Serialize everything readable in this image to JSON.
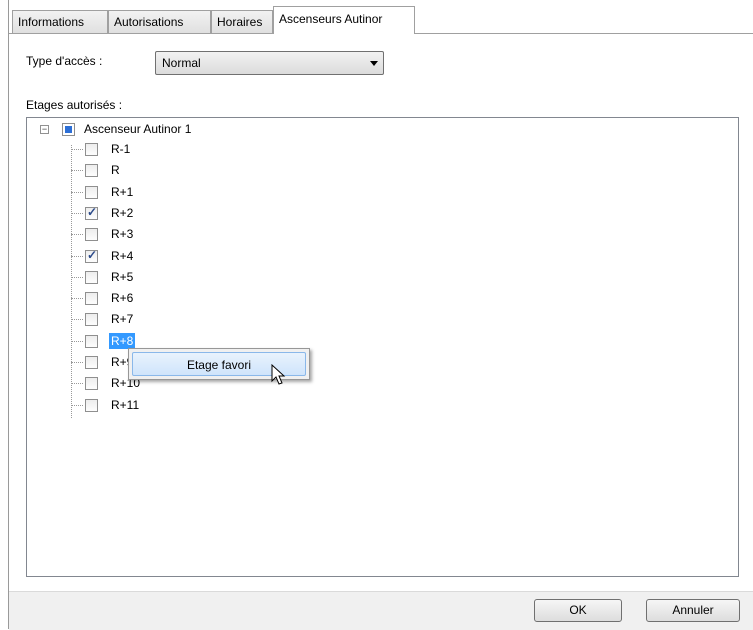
{
  "tabs": [
    {
      "label": "Informations"
    },
    {
      "label": "Autorisations"
    },
    {
      "label": "Horaires"
    },
    {
      "label": "Ascenseurs Autinor"
    }
  ],
  "access": {
    "label": "Type d'accès :",
    "value": "Normal"
  },
  "floors_label": "Etages autorisés :",
  "tree": {
    "root_label": "Ascenseur Autinor 1",
    "items": [
      {
        "label": "R-1",
        "checked": false
      },
      {
        "label": "R",
        "checked": false
      },
      {
        "label": "R+1",
        "checked": false
      },
      {
        "label": "R+2",
        "checked": true
      },
      {
        "label": "R+3",
        "checked": false
      },
      {
        "label": "R+4",
        "checked": true
      },
      {
        "label": "R+5",
        "checked": false
      },
      {
        "label": "R+6",
        "checked": false
      },
      {
        "label": "R+7",
        "checked": false
      },
      {
        "label": "R+8",
        "checked": false,
        "selected": true
      },
      {
        "label": "R+9",
        "checked": false
      },
      {
        "label": "R+10",
        "checked": false
      },
      {
        "label": "R+11",
        "checked": false
      }
    ]
  },
  "context_menu": {
    "item": "Etage favori"
  },
  "buttons": {
    "ok": "OK",
    "cancel": "Annuler"
  }
}
